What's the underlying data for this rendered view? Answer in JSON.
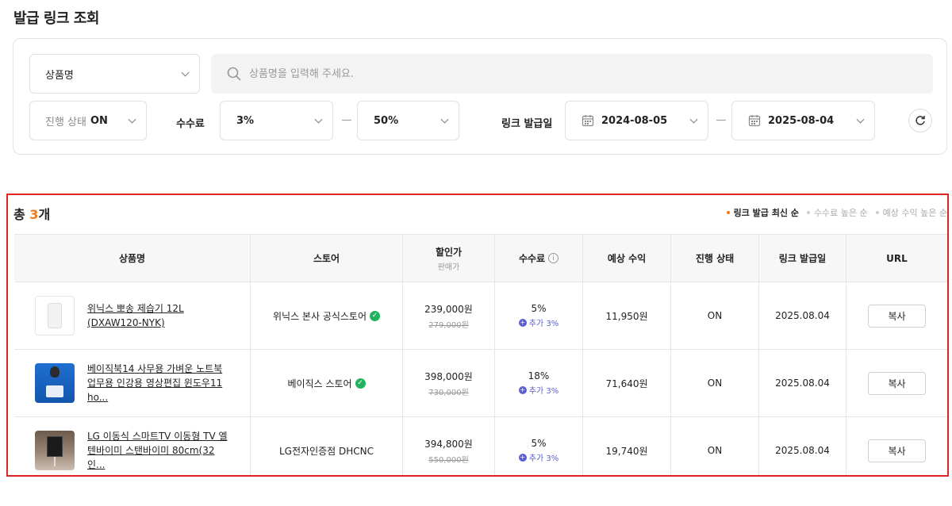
{
  "page_title": "발급 링크 조회",
  "filters": {
    "category": "상품명",
    "search_placeholder": "상품명을 입력해 주세요.",
    "status_label": "진행 상태",
    "status_value": "ON",
    "fee_label": "수수료",
    "fee_min": "3%",
    "fee_max": "50%",
    "date_label": "링크 발급일",
    "date_from": "2024-08-05",
    "date_to": "2025-08-04"
  },
  "results": {
    "total_prefix": "총 ",
    "total_count": "3",
    "total_suffix": "개",
    "sort_options": [
      "링크 발급 최신 순",
      "수수료 높은 순",
      "예상 수익 높은 순"
    ],
    "columns": {
      "product": "상품명",
      "store": "스토어",
      "sale_price": "할인가",
      "sale_price_sub": "판매가",
      "fee": "수수료",
      "expected": "예상 수익",
      "status": "진행 상태",
      "issued": "링크 발급일",
      "url": "URL"
    },
    "rows": [
      {
        "name": "위닉스 뽀송 제습기 12L (DXAW120-NYK)",
        "store": "위닉스 본사 공식스토어",
        "verified": true,
        "price": "239,000원",
        "orig_price": "279,000원",
        "fee": "5%",
        "fee_extra": "추가 3%",
        "expected": "11,950원",
        "status": "ON",
        "date": "2025.08.04",
        "copy": "복사"
      },
      {
        "name": "베이직북14 사무용 가벼운 노트북 업무용 인강용 영상편집 윈도우11 ho...",
        "store": "베이직스 스토어",
        "verified": true,
        "price": "398,000원",
        "orig_price": "730,000원",
        "fee": "18%",
        "fee_extra": "추가 3%",
        "expected": "71,640원",
        "status": "ON",
        "date": "2025.08.04",
        "copy": "복사"
      },
      {
        "name": "LG 이동식 스마트TV 이동형 TV 엘텐바이미 스탠바이미 80cm(32인...",
        "store": "LG전자인증점 DHCNC",
        "verified": false,
        "price": "394,800원",
        "orig_price": "550,000원",
        "fee": "5%",
        "fee_extra": "추가 3%",
        "expected": "19,740원",
        "status": "ON",
        "date": "2025.08.04",
        "copy": "복사"
      }
    ]
  },
  "colors": {
    "accent": "#f27a1a",
    "highlight_border": "#e02424",
    "fee_extra": "#5a5fd4",
    "verified": "#22b35e"
  }
}
